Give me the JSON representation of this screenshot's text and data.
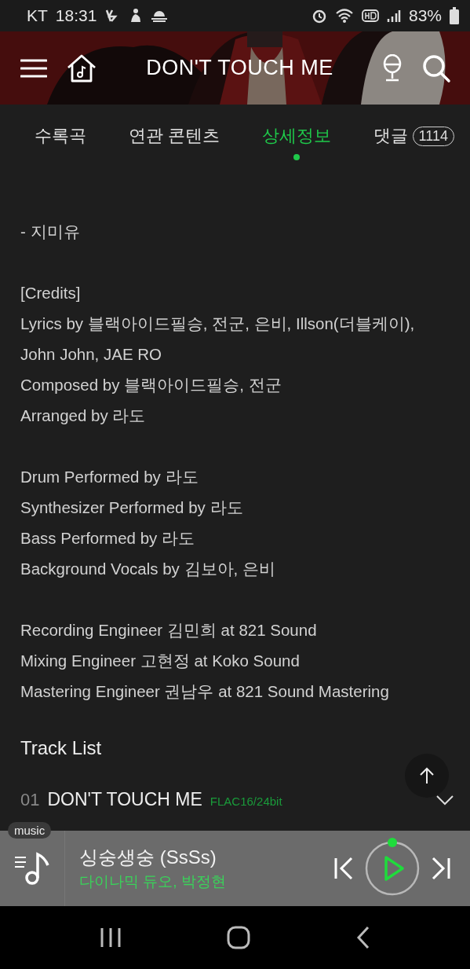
{
  "status_bar": {
    "carrier": "KT",
    "time": "18:31",
    "battery": "83%"
  },
  "header": {
    "title": "DON'T TOUCH ME"
  },
  "tabs": [
    {
      "label": "수록곡",
      "selected": false
    },
    {
      "label": "연관 콘텐츠",
      "selected": false
    },
    {
      "label": "상세정보",
      "selected": true
    },
    {
      "label": "댓글",
      "selected": false,
      "badge": "1114"
    }
  ],
  "details": [
    [
      "- 지미유"
    ],
    [
      "[Credits]",
      "Lyrics by 블랙아이드필승, 전군, 은비, Illson(더블케이),",
      "John John, JAE RO",
      "Composed by 블랙아이드필승, 전군",
      "Arranged by 라도"
    ],
    [
      "Drum Performed by 라도",
      "Synthesizer Performed by 라도",
      "Bass Performed by 라도",
      "Background Vocals by 김보아, 은비"
    ],
    [
      "Recording Engineer 김민희 at 821 Sound",
      "Mixing Engineer 고현정 at Koko Sound",
      "Mastering Engineer 권남우 at 821 Sound Mastering"
    ]
  ],
  "track_list": {
    "heading": "Track List",
    "tracks": [
      {
        "number": "01",
        "title": "DON'T TOUCH ME",
        "quality": "FLAC16/24bit"
      }
    ]
  },
  "player": {
    "badge": "music",
    "title": "싱숭생숭 (SsSs)",
    "artist": "다이나믹 듀오, 박정현"
  }
}
